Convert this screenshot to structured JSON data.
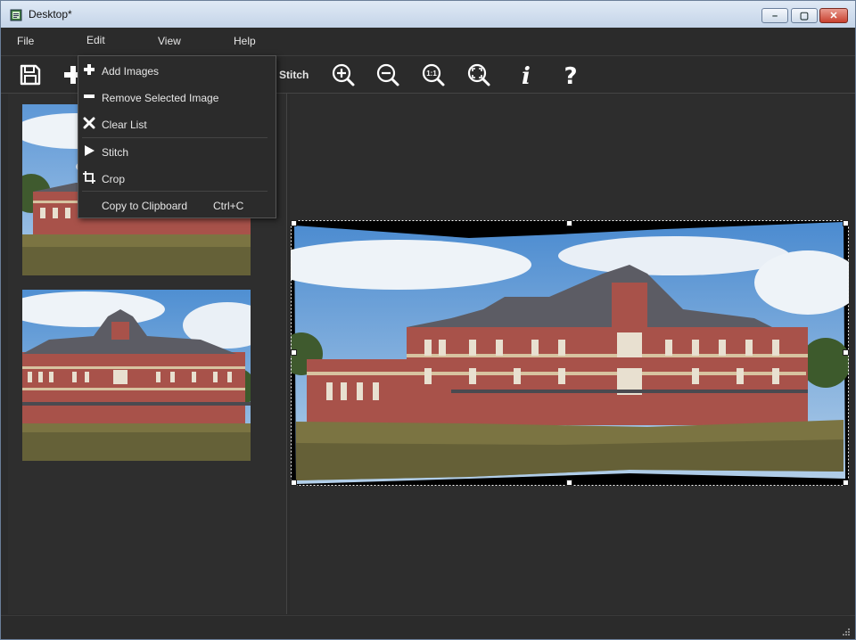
{
  "window": {
    "title": "Desktop*",
    "controls": {
      "minimize": "–",
      "maximize": "▢",
      "close": "✕"
    }
  },
  "menubar": {
    "items": [
      {
        "label": "File"
      },
      {
        "label": "Edit"
      },
      {
        "label": "View"
      },
      {
        "label": "Help"
      }
    ]
  },
  "toolbar": {
    "buttons": [
      {
        "icon": "save-icon"
      },
      {
        "icon": "add-icon"
      },
      {
        "label": "Stitch"
      },
      {
        "icon": "zoom-in-icon"
      },
      {
        "icon": "zoom-out-icon"
      },
      {
        "icon": "zoom-actual-size-icon",
        "text": "1:1"
      },
      {
        "icon": "zoom-fit-icon"
      },
      {
        "icon": "info-icon",
        "text": "i"
      },
      {
        "icon": "help-icon",
        "text": "?"
      }
    ]
  },
  "edit_menu": {
    "items": [
      {
        "label": "Add Images",
        "icon": "plus-icon"
      },
      {
        "label": "Remove Selected Image",
        "icon": "minus-icon"
      },
      {
        "label": "Clear List",
        "icon": "x-icon"
      },
      {
        "label": "Stitch",
        "icon": "play-icon"
      },
      {
        "label": "Crop",
        "icon": "crop-icon"
      },
      {
        "label": "Copy to Clipboard",
        "shortcut": "Ctrl+C"
      }
    ]
  },
  "colors": {
    "background": "#2b2b2b",
    "panel": "#2e2e2e",
    "text": "#e6e6e6",
    "sky": "#8cb8e0",
    "brick": "#a8524a",
    "roof": "#5a5a60",
    "grass": "#7a7440"
  }
}
